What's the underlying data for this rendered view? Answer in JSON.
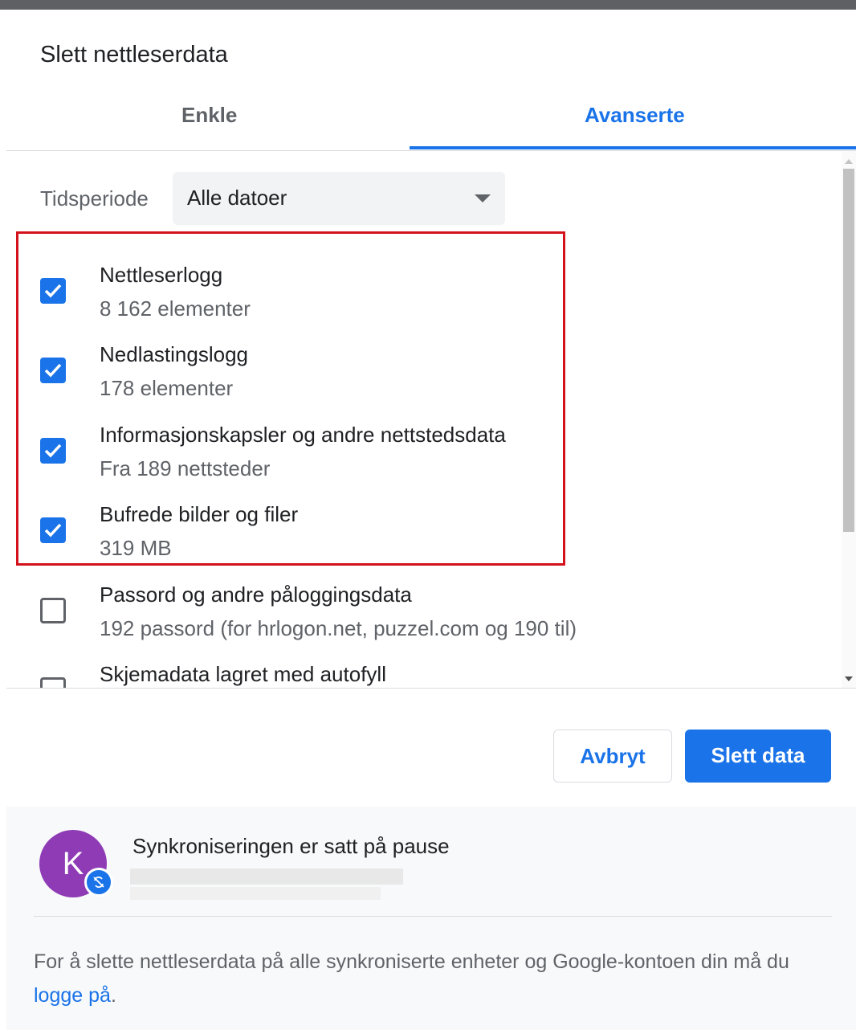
{
  "dialog": {
    "title": "Slett nettleserdata"
  },
  "tabs": [
    {
      "label": "Enkle",
      "selected": false
    },
    {
      "label": "Avanserte",
      "selected": true
    }
  ],
  "time_range": {
    "label": "Tidsperiode",
    "value": "Alle datoer"
  },
  "items": [
    {
      "title": "Nettleserlogg",
      "subtitle": "8 162 elementer",
      "checked": true
    },
    {
      "title": "Nedlastingslogg",
      "subtitle": "178 elementer",
      "checked": true
    },
    {
      "title": "Informasjonskapsler og andre nettstedsdata",
      "subtitle": "Fra 189 nettsteder",
      "checked": true
    },
    {
      "title": "Bufrede bilder og filer",
      "subtitle": "319 MB",
      "checked": true
    },
    {
      "title": "Passord og andre påloggingsdata",
      "subtitle": "192 passord (for hrlogon.net, puzzel.com og 190 til)",
      "checked": false
    },
    {
      "title": "Skjemadata lagret med autofyll",
      "subtitle": "",
      "checked": false
    }
  ],
  "buttons": {
    "cancel": "Avbryt",
    "delete": "Slett data"
  },
  "sync": {
    "avatar_initial": "K",
    "status": "Synkroniseringen er satt på pause",
    "message_prefix": "For å slette nettleserdata på alle synkroniserte enheter og Google-kontoen din må du ",
    "link": "logge på",
    "message_suffix": "."
  },
  "colors": {
    "accent": "#1a73e8",
    "highlight_border": "#d4121b",
    "avatar": "#8e3bb5"
  },
  "icons": [
    "checkbox-checked-icon",
    "dropdown-caret-icon",
    "sync-paused-icon"
  ]
}
